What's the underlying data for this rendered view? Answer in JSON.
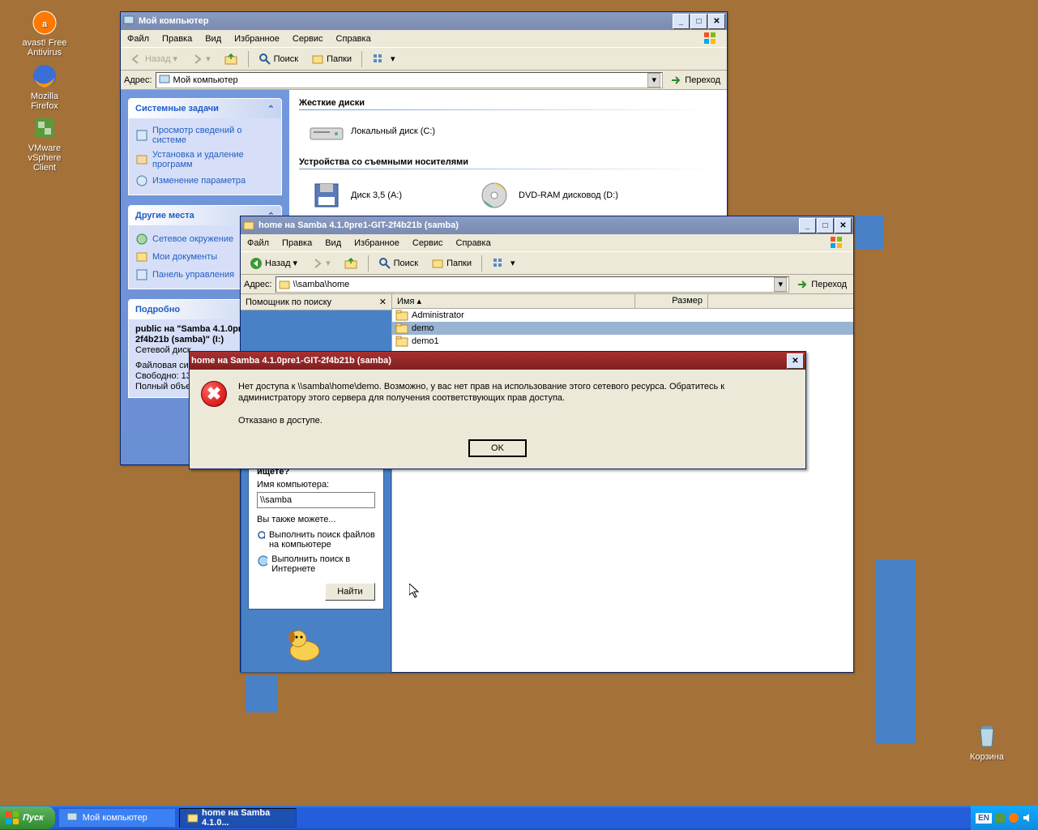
{
  "desktop_icons": [
    {
      "label": "avast! Free Antivirus"
    },
    {
      "label": "Mozilla Firefox"
    },
    {
      "label": "VMware vSphere Client"
    }
  ],
  "recycle": "Корзина",
  "win1": {
    "title": "Мой компьютер",
    "menu": [
      "Файл",
      "Правка",
      "Вид",
      "Избранное",
      "Сервис",
      "Справка"
    ],
    "toolbar": {
      "back": "Назад",
      "search": "Поиск",
      "folders": "Папки"
    },
    "addr_label": "Адрес:",
    "addr_value": "Мой компьютер",
    "go": "Переход",
    "tasks_header": "Системные задачи",
    "tasks": [
      "Просмотр сведений о системе",
      "Установка и удаление программ",
      "Изменение параметра"
    ],
    "places_header": "Другие места",
    "places": [
      "Сетевое окружение",
      "Мои документы",
      "Панель управления"
    ],
    "details_header": "Подробно",
    "details": {
      "line1": "public на \"Samba 4.1.0pre1-GIT-2f4b21b (samba)\" (I:)",
      "line2": "Сетевой диск",
      "line3": "Файловая сис",
      "line4": "Свободно: 13",
      "line5": "Полный объе"
    },
    "sect_hd": "Жесткие диски",
    "drive_c": "Локальный диск (C:)",
    "sect_removable": "Устройства со съемными носителями",
    "floppy": "Диск 3,5 (A:)",
    "dvd": "DVD-RAM дисковод (D:)"
  },
  "win2": {
    "title": "home на Samba 4.1.0pre1-GIT-2f4b21b (samba)",
    "menu": [
      "Файл",
      "Правка",
      "Вид",
      "Избранное",
      "Сервис",
      "Справка"
    ],
    "toolbar": {
      "back": "Назад",
      "search": "Поиск",
      "folders": "Папки"
    },
    "addr_label": "Адрес:",
    "addr_value": "\\\\samba\\home",
    "go": "Переход",
    "search_title": "Помощник по поиску",
    "col_name": "Имя",
    "col_size": "Размер",
    "files": [
      "Administrator",
      "demo",
      "demo1"
    ]
  },
  "dialog": {
    "title": "home на Samba 4.1.0pre1-GIT-2f4b21b (samba)",
    "msg": "Нет доступа к \\\\samba\\home\\demo. Возможно, у вас нет прав на использование этого сетевого ресурса. Обратитесь к администратору этого сервера для получения соответствующих прав доступа.",
    "msg2": "Отказано в доступе.",
    "ok": "OK"
  },
  "search_assistant": {
    "prompt": "ищете?",
    "field_label": "Имя компьютера:",
    "value": "\\\\samba",
    "also": "Вы также можете...",
    "link1": "Выполнить поиск файлов на компьютере",
    "link2": "Выполнить поиск в Интернете",
    "find": "Найти"
  },
  "taskbar": {
    "start": "Пуск",
    "task1": "Мой компьютер",
    "task2": "home на Samba 4.1.0...",
    "lang": "EN"
  }
}
